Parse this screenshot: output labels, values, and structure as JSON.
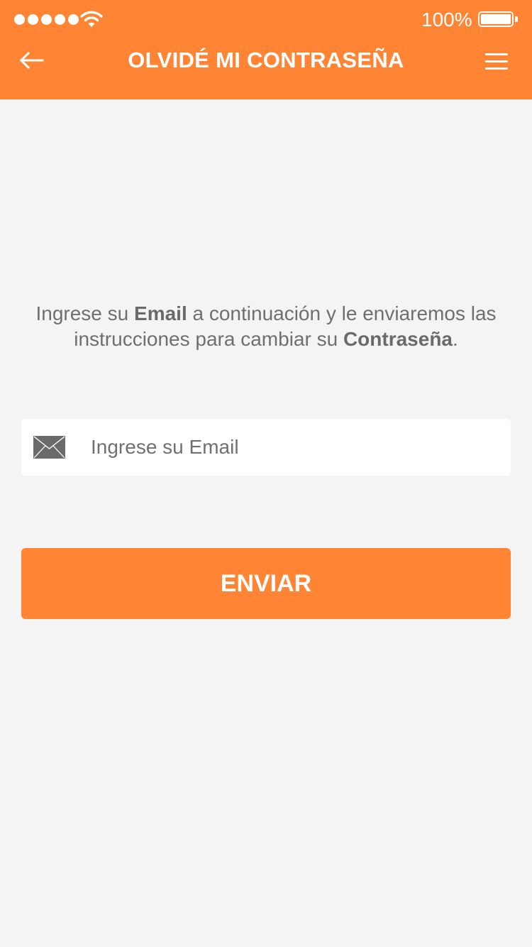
{
  "status_bar": {
    "battery_percent": "100%",
    "battery_level": 1.0,
    "signal_bars": 5
  },
  "nav": {
    "title": "OLVIDÉ MI CONTRASEÑA",
    "back_icon": "arrow-left-icon",
    "menu_icon": "hamburger-menu-icon"
  },
  "instructions": {
    "part1": "Ingrese su ",
    "bold1": "Email",
    "part2": " a continuación y le enviaremos las instrucciones para cambiar su ",
    "bold2": "Contraseña",
    "part3": "."
  },
  "email_field": {
    "placeholder": "Ingrese su Email",
    "icon": "envelope-icon"
  },
  "send_button": {
    "label": "ENVIAR"
  },
  "colors": {
    "accent": "#ff8534",
    "background": "#f4f4f4",
    "text": "#6f6f6f"
  }
}
